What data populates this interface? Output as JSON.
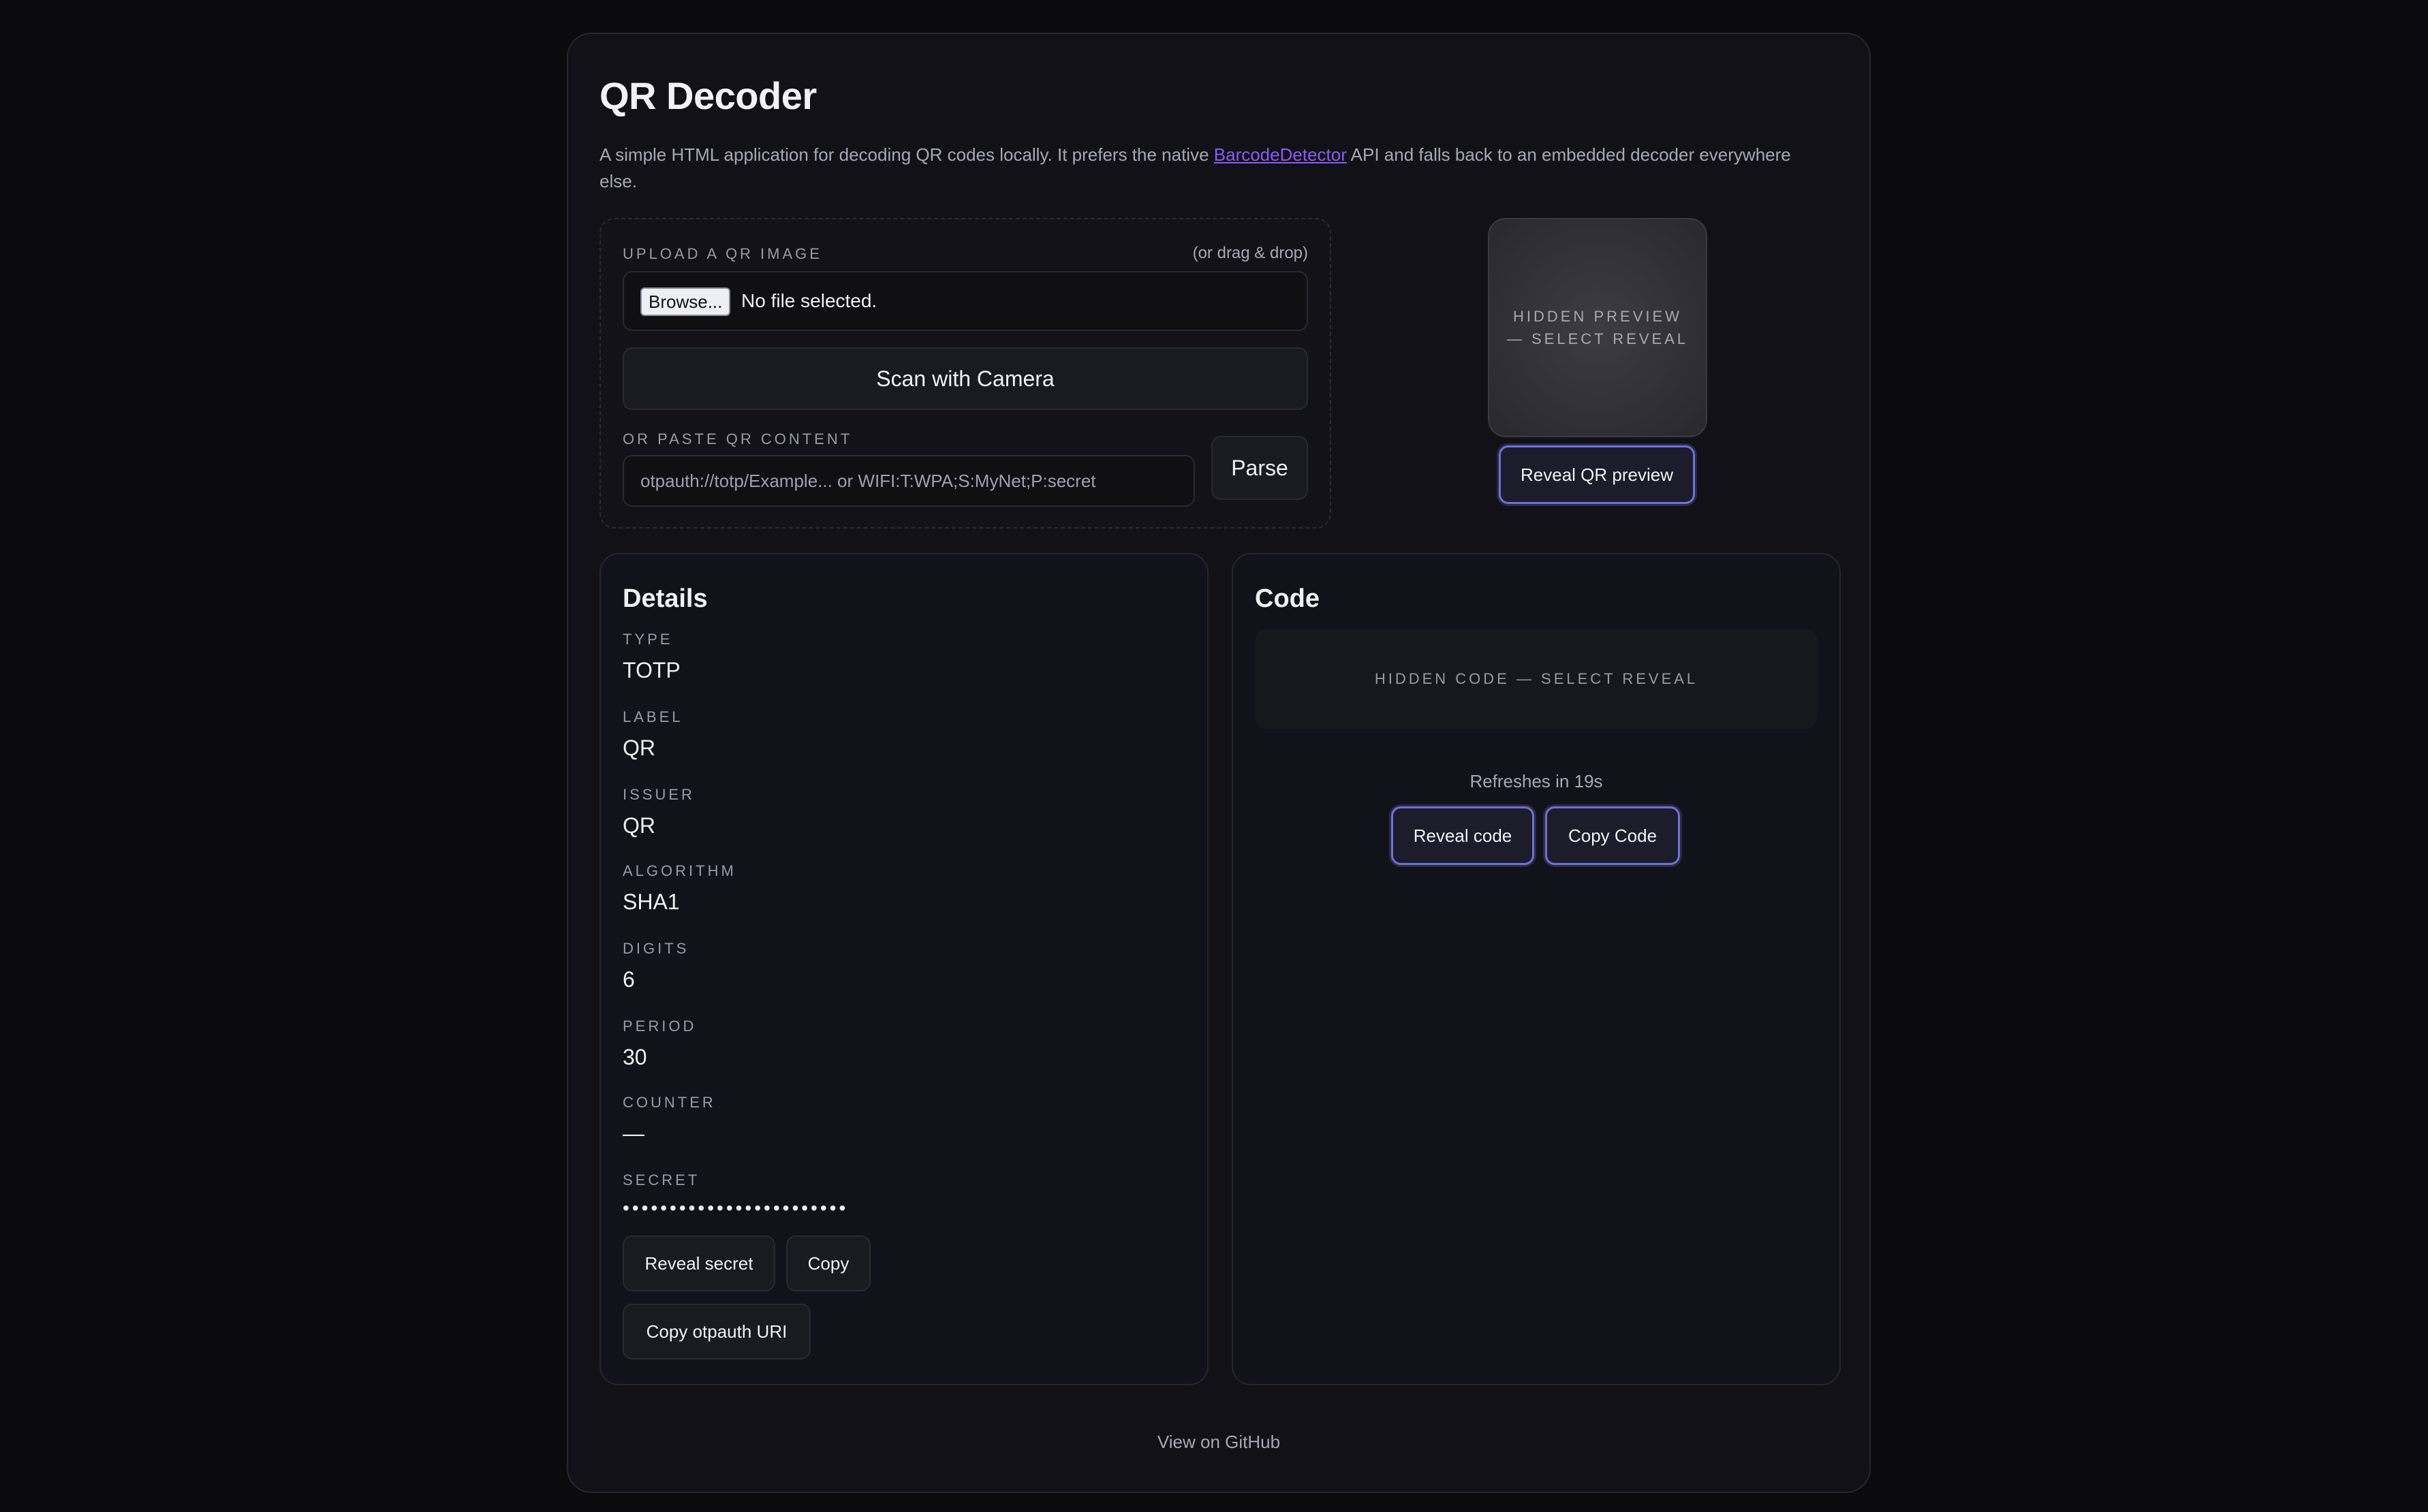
{
  "app": {
    "title": "QR Decoder",
    "intro_before": "A simple HTML application for decoding QR codes locally. It prefers the native ",
    "intro_link": "BarcodeDetector",
    "intro_after": " API and falls back to an embedded decoder everywhere else."
  },
  "upload": {
    "label": "UPLOAD A QR IMAGE",
    "drag_hint": "(or drag & drop)",
    "browse_label": "Browse...",
    "file_status": "No file selected.",
    "scan_label": "Scan with Camera",
    "paste_label": "OR PASTE QR CONTENT",
    "paste_placeholder": "otpauth://totp/Example... or WIFI:T:WPA;S:MyNet;P:secret",
    "parse_label": "Parse"
  },
  "preview": {
    "hidden_text": "HIDDEN PREVIEW — SELECT REVEAL",
    "reveal_label": "Reveal QR preview"
  },
  "details": {
    "title": "Details",
    "fields": [
      {
        "label": "TYPE",
        "value": "TOTP"
      },
      {
        "label": "LABEL",
        "value": "QR"
      },
      {
        "label": "ISSUER",
        "value": "QR"
      },
      {
        "label": "ALGORITHM",
        "value": "SHA1"
      },
      {
        "label": "DIGITS",
        "value": "6"
      },
      {
        "label": "PERIOD",
        "value": "30"
      },
      {
        "label": "COUNTER",
        "value": "—"
      },
      {
        "label": "SECRET",
        "value": "••••••••••••••••••••••••"
      }
    ],
    "reveal_secret_label": "Reveal secret",
    "copy_label": "Copy",
    "copy_uri_label": "Copy otpauth URI"
  },
  "code": {
    "title": "Code",
    "hidden_text": "HIDDEN CODE — SELECT REVEAL",
    "refresh_text": "Refreshes in 19s",
    "reveal_label": "Reveal code",
    "copy_label": "Copy Code"
  },
  "footer": {
    "link_label": "View on GitHub"
  },
  "colors": {
    "background": "#0b0b0f",
    "panel": "#111117",
    "accent_outline": "#6e70d8",
    "link": "#8a5cf5"
  }
}
